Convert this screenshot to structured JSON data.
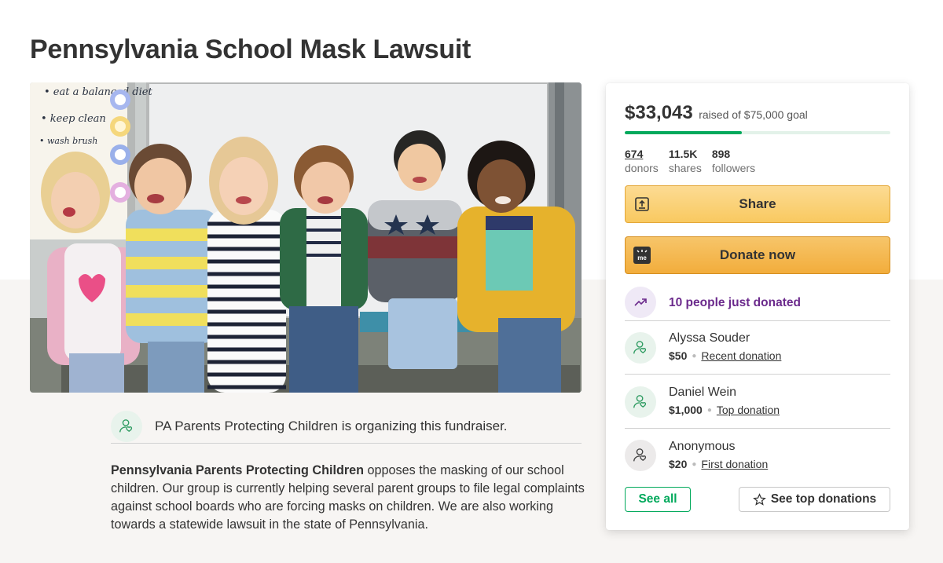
{
  "campaign": {
    "title": "Pennsylvania School Mask Lawsuit"
  },
  "hero": {
    "board_text": [
      "• eat a balanced diet",
      "• keep clean",
      "• wash brush"
    ]
  },
  "organizer": {
    "text": "PA Parents Protecting Children is organizing this fundraiser."
  },
  "story": {
    "lead": "Pennsylvania Parents Protecting Children",
    "body": " opposes the masking of our school children. Our group is currently helping several parent groups to file legal complaints against school boards who are forcing masks on children. We are also working towards a statewide lawsuit in the state of Pennsylvania."
  },
  "card": {
    "amount": "$33,043",
    "goal_text": "raised of $75,000 goal",
    "progress_fraction": 0.44,
    "stats": [
      {
        "value": "674",
        "label": "donors",
        "linked": true
      },
      {
        "value": "11.5K",
        "label": "shares",
        "linked": false
      },
      {
        "value": "898",
        "label": "followers",
        "linked": false
      }
    ],
    "share_label": "Share",
    "donate_label": "Donate now",
    "donate_icon_text": "me",
    "trending_text": "10 people just donated",
    "donations": [
      {
        "name": "Alyssa Souder",
        "amount": "$50",
        "kind": "Recent donation",
        "icon": "donor-heart-icon"
      },
      {
        "name": "Daniel Wein",
        "amount": "$1,000",
        "kind": "Top donation",
        "icon": "donor-heart-icon"
      },
      {
        "name": "Anonymous",
        "amount": "$20",
        "kind": "First donation",
        "icon": "donor-heart-icon"
      }
    ],
    "see_all_label": "See all",
    "see_top_label": "See top donations"
  },
  "colors": {
    "green": "#02a95c",
    "purple": "#6b2a8c",
    "share_button": "#f9c960",
    "donate_button": "#f2ad3c"
  }
}
